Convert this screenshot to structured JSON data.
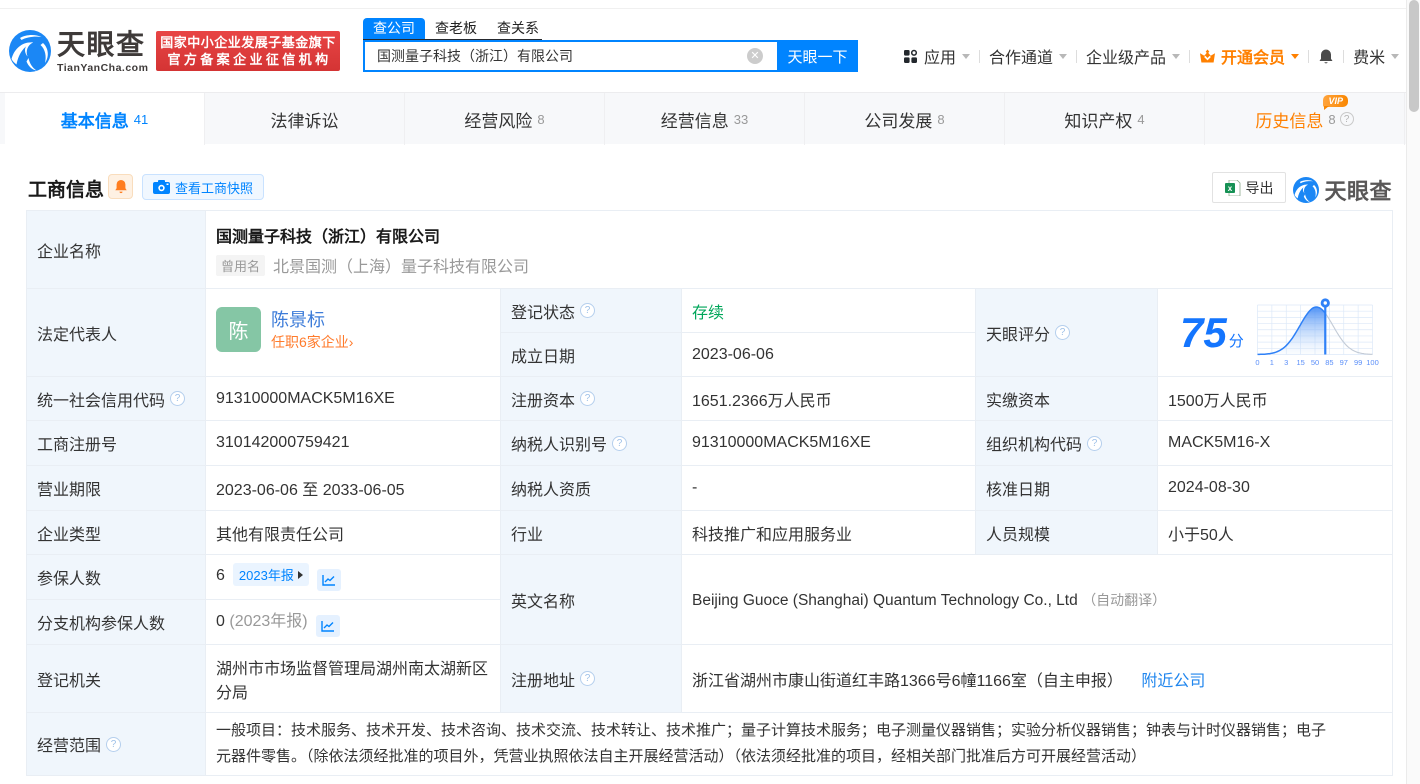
{
  "brand": {
    "name": "天眼查",
    "domain": "TianYanCha.com",
    "badge_line1": "国家中小企业发展子基金旗下",
    "badge_line2": "官方备案企业征信机构",
    "accent_color": "#0084ff",
    "badge_color": "#e23c3a"
  },
  "search": {
    "tabs": [
      {
        "label": "查公司",
        "active": true
      },
      {
        "label": "查老板",
        "active": false
      },
      {
        "label": "查关系",
        "active": false
      }
    ],
    "value": "国测量子科技（浙江）有限公司",
    "button": "天眼一下"
  },
  "topnav": {
    "apps": "应用",
    "coop": "合作通道",
    "enterprise": "企业级产品",
    "vip": "开通会员",
    "user": "费米"
  },
  "tabs": [
    {
      "label": "基本信息",
      "count": "41"
    },
    {
      "label": "法律诉讼",
      "count": ""
    },
    {
      "label": "经营风险",
      "count": "8"
    },
    {
      "label": "经营信息",
      "count": "33"
    },
    {
      "label": "公司发展",
      "count": "8"
    },
    {
      "label": "知识产权",
      "count": "4"
    },
    {
      "label": "历史信息",
      "count": "8",
      "vip_tag": "VIP"
    }
  ],
  "section": {
    "title": "工商信息",
    "snapshot_button": "查看工商快照",
    "export_button": "导出",
    "watermark": "天眼查"
  },
  "fields": {
    "name_label": "企业名称",
    "name": "国测量子科技（浙江）有限公司",
    "former_tag": "曾用名",
    "former_name": "北景国测（上海）量子科技有限公司",
    "legal_label": "法定代表人",
    "legal_avatar": "陈",
    "legal_name": "陈景标",
    "legal_link": "任职6家企业›",
    "reg_status_label": "登记状态",
    "reg_status": "存续",
    "est_date_label": "成立日期",
    "est_date": "2023-06-06",
    "score_label": "天眼评分",
    "uscc_label": "统一社会信用代码",
    "uscc": "91310000MACK5M16XE",
    "reg_capital_label": "注册资本",
    "reg_capital": "1651.2366万人民币",
    "paid_capital_label": "实缴资本",
    "paid_capital": "1500万人民币",
    "reg_no_label": "工商注册号",
    "reg_no": "310142000759421",
    "tax_id_label": "纳税人识别号",
    "tax_id": "91310000MACK5M16XE",
    "org_code_label": "组织机构代码",
    "org_code": "MACK5M16-X",
    "term_label": "营业期限",
    "term": "2023-06-06 至 2033-06-05",
    "tax_qual_label": "纳税人资质",
    "tax_qual": "-",
    "approve_date_label": "核准日期",
    "approve_date": "2024-08-30",
    "type_label": "企业类型",
    "type": "其他有限责任公司",
    "industry_label": "行业",
    "industry": "科技推广和应用服务业",
    "staff_label": "人员规模",
    "staff": "小于50人",
    "insured_label": "参保人数",
    "insured": "6",
    "insured_badge": "2023年报",
    "branch_insured_label": "分支机构参保人数",
    "branch_insured": "0",
    "branch_insured_note": "(2023年报)",
    "en_name_label": "英文名称",
    "en_name": "Beijing Guoce (Shanghai) Quantum Technology Co., Ltd",
    "en_name_note": "（自动翻译）",
    "authority_label": "登记机关",
    "authority": "湖州市市场监督管理局湖州南太湖新区分局",
    "address_label": "注册地址",
    "address": "浙江省湖州市康山街道红丰路1366号6幢1166室（自主申报）",
    "address_link": "附近公司",
    "scope_label": "经营范围",
    "scope": "一般项目：技术服务、技术开发、技术咨询、技术交流、技术转让、技术推广；量子计算技术服务；电子测量仪器销售；实验分析仪器销售；钟表与计时仪器销售；电子元器件零售。（除依法须经批准的项目外，凭营业执照依法自主开展经营活动）（依法须经批准的项目，经相关部门批准后方可开展经营活动）"
  },
  "icons": {
    "help_glyph": "?",
    "clear_glyph": "✕"
  },
  "chart_data": {
    "type": "area",
    "title": "天眼评分",
    "score": 75,
    "unit": "分",
    "x_ticks": [
      "0",
      "1",
      "3",
      "15",
      "50",
      "85",
      "97",
      "99",
      "100"
    ],
    "marker_at": 75,
    "curve": "bell distribution of scores, filled blue left of marker, gray right tail"
  }
}
